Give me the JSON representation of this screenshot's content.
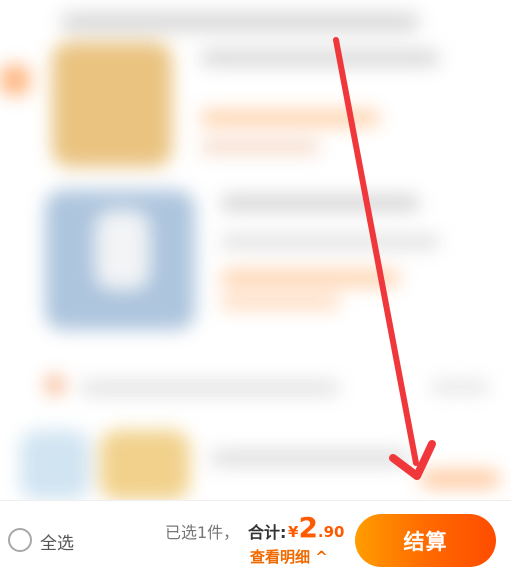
{
  "footer": {
    "select_all_label": "全选",
    "selected_count_label": "已选1件，",
    "total_label": "合计:",
    "price": {
      "currency": "¥",
      "integer": "2",
      "decimal": ".90"
    },
    "detail_label": "查看明细",
    "detail_chevron": "^",
    "checkout_label": "结算"
  },
  "colors": {
    "accent": "#ff5a00",
    "checkout_gradient_start": "#ff9d00",
    "checkout_gradient_end": "#ff4c00",
    "annotation_arrow": "#f0373c"
  },
  "icons": [
    "radio-unchecked-icon",
    "chevron-up-icon",
    "annotation-arrow"
  ]
}
